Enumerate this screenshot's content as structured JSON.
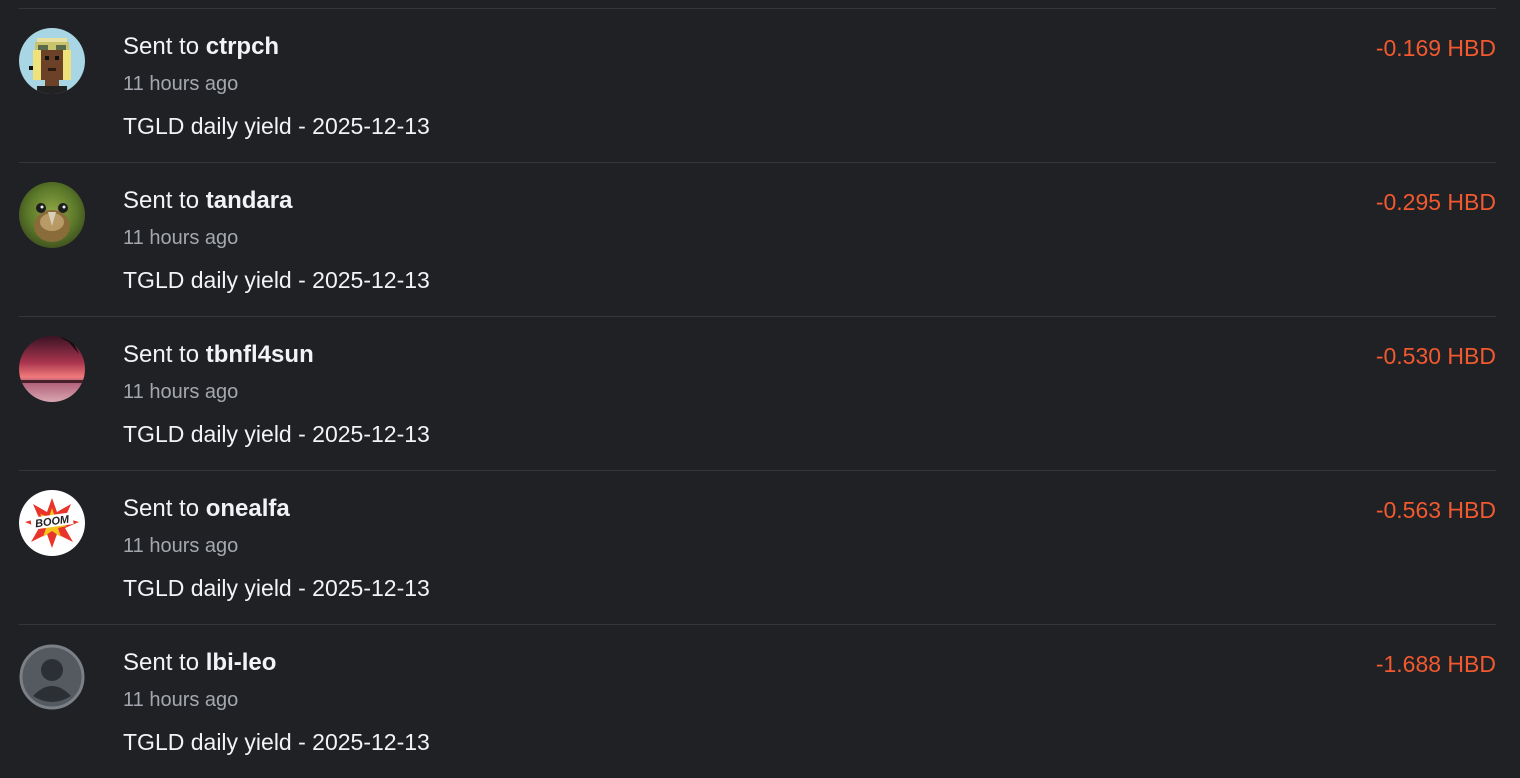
{
  "transactions": [
    {
      "prefix": "Sent to",
      "recipient": "ctrpch",
      "time": "11 hours ago",
      "memo": "TGLD daily yield - 2025-12-13",
      "amount": "-0.169 HBD",
      "avatar_icon": "pixel-punk-avatar"
    },
    {
      "prefix": "Sent to",
      "recipient": "tandara",
      "time": "11 hours ago",
      "memo": "TGLD daily yield - 2025-12-13",
      "amount": "-0.295 HBD",
      "avatar_icon": "kakapo-parrot-avatar"
    },
    {
      "prefix": "Sent to",
      "recipient": "tbnfl4sun",
      "time": "11 hours ago",
      "memo": "TGLD daily yield - 2025-12-13",
      "amount": "-0.530 HBD",
      "avatar_icon": "sunset-beach-avatar"
    },
    {
      "prefix": "Sent to",
      "recipient": "onealfa",
      "time": "11 hours ago",
      "memo": "TGLD daily yield - 2025-12-13",
      "amount": "-0.563 HBD",
      "avatar_icon": "boom-comic-avatar"
    },
    {
      "prefix": "Sent to",
      "recipient": "lbi-leo",
      "time": "11 hours ago",
      "memo": "TGLD daily yield - 2025-12-13",
      "amount": "-1.688 HBD",
      "avatar_icon": "default-user-avatar"
    }
  ],
  "colors": {
    "background": "#1f2125",
    "divider": "#33363b",
    "primary_text": "#f2f3f5",
    "secondary_text": "#a4a8ae",
    "negative_amount": "#f2592f"
  }
}
